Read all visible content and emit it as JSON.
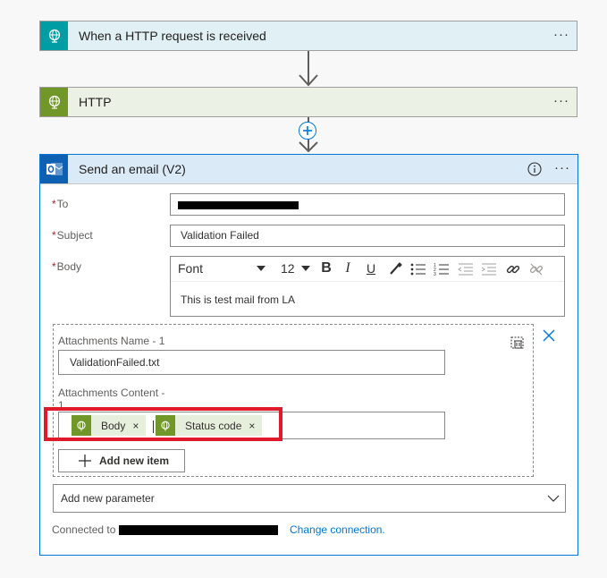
{
  "trigger": {
    "title": "When a HTTP request is received",
    "more": "···"
  },
  "http": {
    "title": "HTTP",
    "more": "···"
  },
  "email": {
    "title": "Send an email (V2)",
    "more": "···",
    "to": {
      "label": "To",
      "required": "*"
    },
    "subject": {
      "label": "Subject",
      "required": "*",
      "value": "Validation Failed"
    },
    "body": {
      "label": "Body",
      "required": "*",
      "font": "Font",
      "size": "12",
      "text": "This is test mail from LA",
      "bold": "B",
      "italic": "I",
      "underline": "U"
    },
    "attachments": {
      "name_label": "Attachments Name - 1",
      "name_value": "ValidationFailed.txt",
      "content_label_1": "Attachments Content -",
      "content_label_2": "1",
      "tokens": [
        {
          "label": "Body",
          "remove": "×"
        },
        {
          "label": "Status code",
          "remove": "×"
        }
      ],
      "add_item": "Add new item"
    },
    "add_parameter": "Add new parameter",
    "connected_to": "Connected to",
    "change_connection": "Change connection."
  },
  "colors": {
    "accent": "#0078d4",
    "http_green": "#709727",
    "trigger_teal": "#009da5",
    "outlook_blue": "#0e61b2",
    "highlight_red": "#e01a2a"
  }
}
